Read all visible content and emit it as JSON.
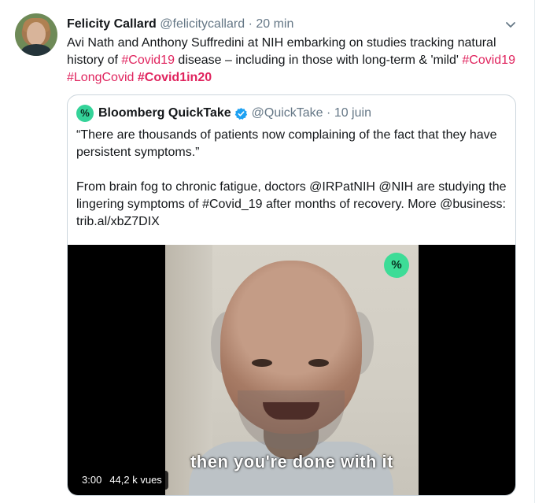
{
  "tweet": {
    "author_name": "Felicity Callard",
    "author_handle": "@felicitycallard",
    "separator": "·",
    "time": "20 min",
    "text_part1": "Avi Nath and Anthony Suffredini at NIH embarking on studies tracking natural history of ",
    "hashtag1": "#Covid19",
    "text_part2": " disease – including in those with long-term & 'mild' ",
    "hashtag2": "#Covid19",
    "hashtag3": "#LongCovid",
    "hashtag4": "#Covid1in20",
    "menu_icon": "chevron-down-icon"
  },
  "quote": {
    "logo_glyph": "%",
    "author_name": "Bloomberg QuickTake",
    "author_handle": "@QuickTake",
    "separator": "·",
    "time": "10 juin",
    "paragraph1": "“There are thousands of patients now complaining of the fact that they have persistent symptoms.”",
    "paragraph2": "From brain fog to chronic fatigue, doctors @IRPatNIH @NIH are studying the lingering symptoms of #Covid_19 after months of recovery. More @business: trib.al/xbZ7DIX"
  },
  "video": {
    "badge_glyph": "%",
    "caption": "then you're done with it",
    "duration": "3:00",
    "views": "44,2 k vues"
  },
  "colors": {
    "hashtag": "#e0245e",
    "muted": "#657786",
    "quicktake_green": "#3ddc97",
    "verified_blue": "#1da1f2"
  }
}
